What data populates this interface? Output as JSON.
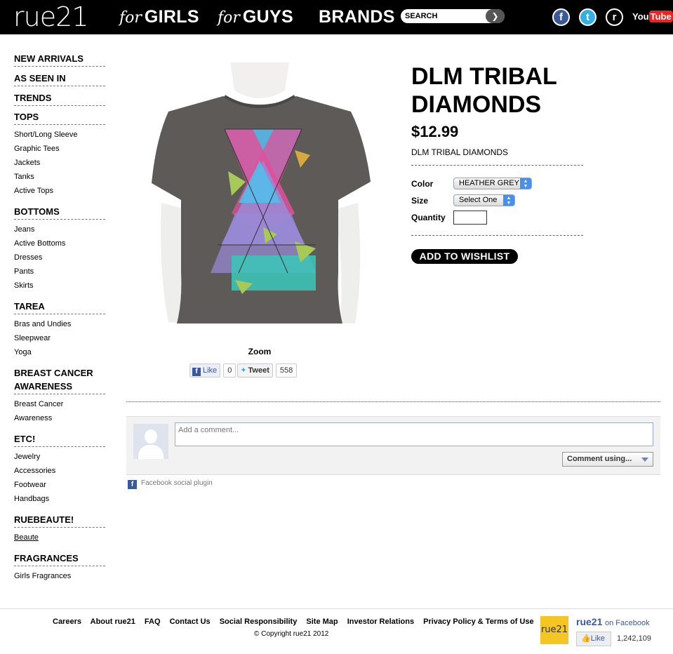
{
  "header": {
    "logo": "rue21",
    "nav": [
      {
        "prefix": "for",
        "label": "GIRLS"
      },
      {
        "prefix": "for",
        "label": "GUYS"
      },
      {
        "prefix": "",
        "label": "BRANDS"
      }
    ],
    "search_placeholder": "SEARCH",
    "social": {
      "facebook": "f",
      "twitter": "t",
      "rss": "r",
      "youtube_you": "You",
      "youtube_tube": "Tube"
    }
  },
  "sidebar": {
    "new_arrivals": "NEW ARRIVALS",
    "as_seen_in": "AS SEEN IN",
    "trends": "TRENDS",
    "tops": "TOPS",
    "tops_items": [
      "Short/Long Sleeve",
      "Graphic Tees",
      "Jackets",
      "Tanks",
      "Active Tops"
    ],
    "bottoms": "BOTTOMS",
    "bottoms_items": [
      "Jeans",
      "Active Bottoms",
      "Dresses",
      "Pants",
      "Skirts"
    ],
    "tarea": "TAREA",
    "tarea_items": [
      "Bras and Undies",
      "Sleepwear",
      "Yoga"
    ],
    "breast_cancer": "BREAST CANCER AWARENESS",
    "breast_cancer_items": [
      "Breast Cancer",
      "Awareness"
    ],
    "etc": "ETC!",
    "etc_items": [
      "Jewelry",
      "Accessories",
      "Footwear",
      "Handbags"
    ],
    "ruebeaute": "RUEBEAUTE!",
    "ruebeaute_items": [
      "Beaute"
    ],
    "fragrances": "FRAGRANCES",
    "fragrances_items": [
      "Girls Fragrances"
    ]
  },
  "product": {
    "title": "DLM TRIBAL DIAMONDS",
    "price": "$12.99",
    "subtitle": "DLM TRIBAL DIAMONDS",
    "color_label": "Color",
    "color_value": "HEATHER GREY",
    "size_label": "Size",
    "size_value": "Select One",
    "quantity_label": "Quantity",
    "quantity_value": "",
    "wishlist_label": "ADD TO WISHLIST",
    "zoom_label": "Zoom",
    "colors": {
      "shirt": "#5e5a58",
      "pink": "#e0509a",
      "blue": "#58b8e8",
      "teal": "#3ac8b8",
      "lavender": "#9a8ad8",
      "green": "#a8c858"
    }
  },
  "share": {
    "like_label": "Like",
    "like_count": "0",
    "tweet_label": "Tweet",
    "tweet_count": "558"
  },
  "comments": {
    "placeholder": "Add a comment...",
    "comment_using": "Comment using...",
    "plugin_label": "Facebook social plugin"
  },
  "footer": {
    "links": [
      "Careers",
      "About rue21",
      "FAQ",
      "Contact Us",
      "Social Responsibility",
      "Site Map",
      "Investor Relations",
      "Privacy Policy & Terms of Use"
    ],
    "copyright": "© Copyright rue21 2012",
    "fb_brand": "rue21",
    "fb_name": "rue21",
    "fb_on": "on Facebook",
    "fb_like": "Like",
    "fb_count": "1,242,109"
  }
}
